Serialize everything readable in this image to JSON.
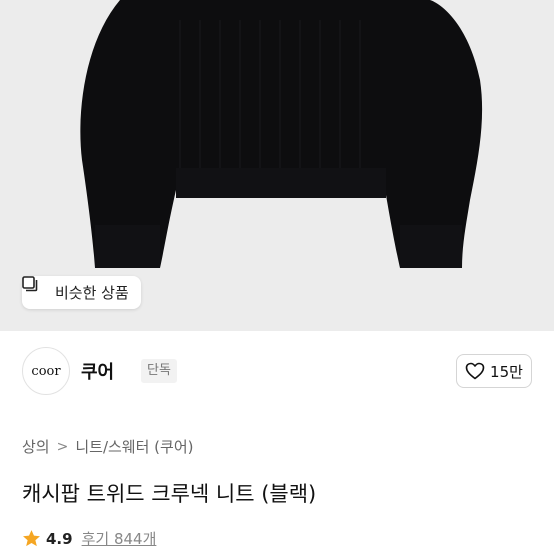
{
  "hero": {
    "similar_button_label": "비슷한 상품",
    "similar_button_icon": "gallery-icon"
  },
  "brand": {
    "logo_text": "coor",
    "name": "쿠어",
    "badge": "단독"
  },
  "like": {
    "count": "15만",
    "icon": "heart-outline-icon"
  },
  "breadcrumb": {
    "items": [
      "상의",
      "니트/스웨터 (쿠어)"
    ],
    "separator": ">"
  },
  "product": {
    "title": "캐시팝 트위드 크루넥 니트 (블랙)",
    "rating": "4.9",
    "reviews_label": "후기 844개"
  },
  "colors": {
    "star": "#f5a623",
    "hero_background": "#ececec",
    "sweater": "#0d0d0f"
  }
}
